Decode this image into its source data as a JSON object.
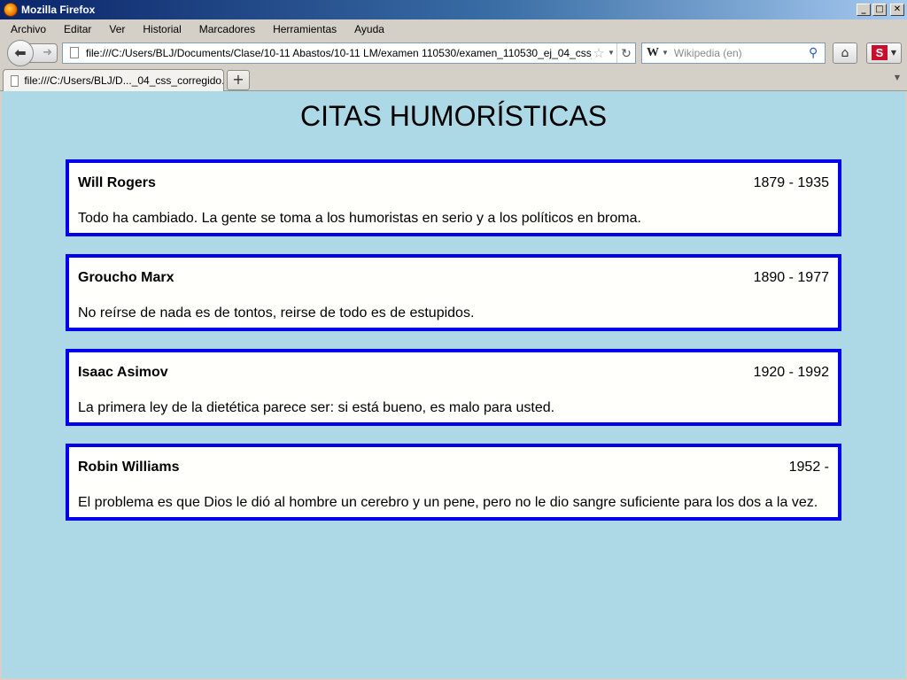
{
  "window": {
    "title": "Mozilla Firefox",
    "controls": {
      "minimize": "_",
      "maximize": "□",
      "close": "✕"
    }
  },
  "menu": [
    "Archivo",
    "Editar",
    "Ver",
    "Historial",
    "Marcadores",
    "Herramientas",
    "Ayuda"
  ],
  "navbar": {
    "url": "file:///C:/Users/BLJ/Documents/Clase/10-11 Abastos/10-11 LM/examen 110530/examen_110530_ej_04_css_correg",
    "search_engine_icon": "W",
    "search_placeholder": "Wikipedia (en)",
    "addon_icon": "S"
  },
  "tabs": [
    {
      "label": "file:///C:/Users/BLJ/D..._04_css_corregido.xml"
    }
  ],
  "page": {
    "title": "CITAS HUMORÍSTICAS",
    "colors": {
      "background": "#add8e6",
      "border": "#0000ee",
      "card": "#fffffb"
    },
    "quotes": [
      {
        "author": "Will Rogers",
        "dates": "1879 - 1935",
        "text": "Todo ha cambiado. La gente se toma a los humoristas en serio y a los políticos en broma."
      },
      {
        "author": "Groucho Marx",
        "dates": "1890 - 1977",
        "text": "No reírse de nada es de tontos, reirse de todo es de estupidos."
      },
      {
        "author": "Isaac Asimov",
        "dates": "1920 - 1992",
        "text": "La primera ley de la dietética parece ser: si está bueno, es malo para usted."
      },
      {
        "author": "Robin Williams",
        "dates": "1952 -",
        "text": "El problema es que Dios le dió al hombre un cerebro y un pene, pero no le dio sangre suficiente para los dos a la vez."
      }
    ]
  }
}
